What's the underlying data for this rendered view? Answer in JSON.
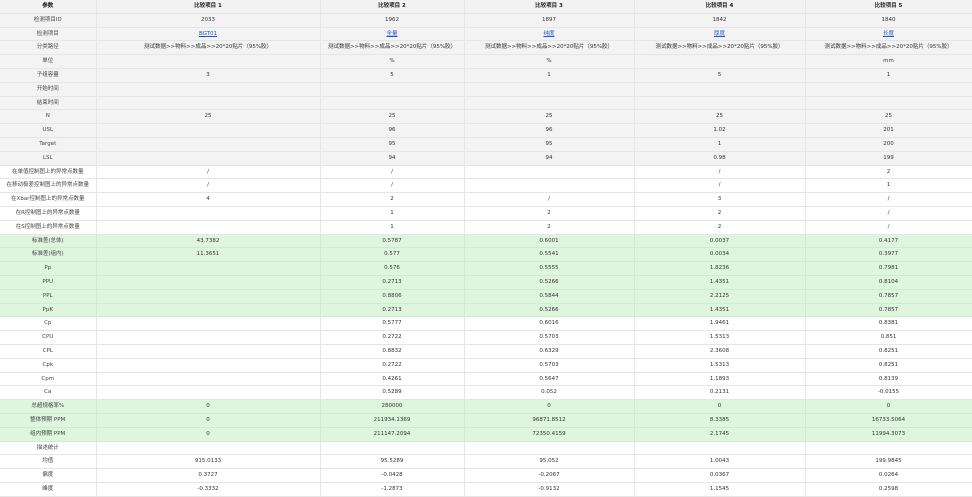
{
  "header": {
    "param_label": "参数",
    "items": [
      "比较项目 1",
      "比较项目 2",
      "比较项目 3",
      "比较项目 4",
      "比较项目 5"
    ]
  },
  "rows": [
    {
      "label": "检测项目ID",
      "values": [
        "2033",
        "1962",
        "1897",
        "1842",
        "1840"
      ],
      "group": "grey"
    },
    {
      "label": "检测项目",
      "values": [
        "BGT01",
        "全量",
        "纯度",
        "厚度",
        "长度"
      ],
      "group": "grey",
      "links": true
    },
    {
      "label": "分类路径",
      "values": [
        "测试数据>>物料>>成品>>20*20贴片（95%胶）",
        "测试数据>>物料>>成品>>20*20贴片（95%胶）",
        "测试数据>>物料>>成品>>20*20贴片（95%胶）",
        "测试数据>>物料>>成品>>20*20贴片（95%胶）",
        "测试数据>>物料>>成品>>20*20贴片（95%胶）"
      ],
      "group": "grey"
    },
    {
      "label": "单位",
      "values": [
        "",
        "%",
        "%",
        "",
        "mm"
      ],
      "group": "grey"
    },
    {
      "label": "子组容量",
      "values": [
        "3",
        "5",
        "1",
        "5",
        "1"
      ],
      "group": "grey"
    },
    {
      "label": "开始时间",
      "values": [
        "",
        "",
        "",
        "",
        ""
      ],
      "group": "grey"
    },
    {
      "label": "结束时间",
      "values": [
        "",
        "",
        "",
        "",
        ""
      ],
      "group": "grey"
    },
    {
      "label": "N",
      "values": [
        "25",
        "25",
        "25",
        "25",
        "25"
      ],
      "group": "grey"
    },
    {
      "label": "USL",
      "values": [
        "",
        "96",
        "96",
        "1.02",
        "201"
      ],
      "group": "grey"
    },
    {
      "label": "Target",
      "values": [
        "",
        "95",
        "95",
        "1",
        "200"
      ],
      "group": "grey"
    },
    {
      "label": "LSL",
      "values": [
        "",
        "94",
        "94",
        "0.98",
        "199"
      ],
      "group": "grey"
    },
    {
      "label": "在单值控制图上的异常点数量",
      "values": [
        "/",
        "/",
        "",
        "/",
        "2"
      ],
      "group": "white"
    },
    {
      "label": "在移动极差控制图上的异常点数量",
      "values": [
        "/",
        "/",
        "",
        "/",
        "1"
      ],
      "group": "white"
    },
    {
      "label": "在Xbar控制图上的异常点数量",
      "values": [
        "4",
        "2",
        "/",
        "3",
        "/"
      ],
      "group": "white"
    },
    {
      "label": "在R控制图上的异常点数量",
      "values": [
        "",
        "1",
        "2",
        "2",
        "/"
      ],
      "group": "white"
    },
    {
      "label": "在S控制图上的异常点数量",
      "values": [
        "",
        "1",
        "2",
        "2",
        "/"
      ],
      "group": "white"
    },
    {
      "label": "标准差(总体)",
      "values": [
        "43.7382",
        "0.5787",
        "0.6001",
        "0.0037",
        "0.4177"
      ],
      "group": "green"
    },
    {
      "label": "标准差(组内)",
      "values": [
        "11.3651",
        "0.577",
        "0.5541",
        "0.0034",
        "0.3977"
      ],
      "group": "green"
    },
    {
      "label": "Pp",
      "values": [
        "",
        "0.576",
        "0.5555",
        "1.8236",
        "0.7981"
      ],
      "group": "green"
    },
    {
      "label": "PPU",
      "values": [
        "",
        "0.2713",
        "0.5266",
        "1.4351",
        "0.8104"
      ],
      "group": "green"
    },
    {
      "label": "PPL",
      "values": [
        "",
        "0.8806",
        "0.5844",
        "2.2125",
        "0.7857"
      ],
      "group": "green"
    },
    {
      "label": "PpK",
      "values": [
        "",
        "0.2713",
        "0.5266",
        "1.4351",
        "0.7857"
      ],
      "group": "green"
    },
    {
      "label": "Cp",
      "values": [
        "",
        "0.5777",
        "0.6016",
        "1.9461",
        "0.8381"
      ],
      "group": "white"
    },
    {
      "label": "CPU",
      "values": [
        "",
        "0.2722",
        "0.5703",
        "1.5313",
        "0.851"
      ],
      "group": "white"
    },
    {
      "label": "CPL",
      "values": [
        "",
        "0.8832",
        "0.6329",
        "2.3608",
        "0.8251"
      ],
      "group": "white"
    },
    {
      "label": "Cpk",
      "values": [
        "",
        "0.2722",
        "0.5703",
        "1.5313",
        "0.8251"
      ],
      "group": "white"
    },
    {
      "label": "Cpm",
      "values": [
        "",
        "0.4261",
        "0.5647",
        "1.1893",
        "0.8139"
      ],
      "group": "white"
    },
    {
      "label": "Ca",
      "values": [
        "",
        "0.5289",
        "0.052",
        "0.2131",
        "-0.0155"
      ],
      "group": "white"
    },
    {
      "label": "总超规格率%",
      "values": [
        "0",
        "280000",
        "0",
        "0",
        "0"
      ],
      "group": "green2"
    },
    {
      "label": "整体预期 PPM",
      "values": [
        "0",
        "211934.1369",
        "96871.8512",
        "8.3385",
        "16733.5064"
      ],
      "group": "green2"
    },
    {
      "label": "组内预期 PPM",
      "values": [
        "0",
        "211147.2094",
        "72350.4159",
        "2.1745",
        "11994.3073"
      ],
      "group": "green2"
    },
    {
      "label": "描述统计",
      "values": [
        "",
        "",
        "",
        "",
        ""
      ],
      "group": "white"
    },
    {
      "label": "均值",
      "values": [
        "915.0133",
        "95.5289",
        "95.052",
        "1.0043",
        "199.9845"
      ],
      "group": "white"
    },
    {
      "label": "偏度",
      "values": [
        "0.3727",
        "-0.0428",
        "-0.2067",
        "0.0367",
        "0.0264"
      ],
      "group": "white"
    },
    {
      "label": "峰度",
      "values": [
        "-0.3332",
        "-1.2873",
        "-0.9132",
        "1.1545",
        "0.2598"
      ],
      "group": "white"
    }
  ],
  "colors": {
    "grey_row": "#f3f3f3",
    "green_row": "#ddf6dd",
    "header": "#f2f2f2",
    "link": "#1a56d6"
  }
}
